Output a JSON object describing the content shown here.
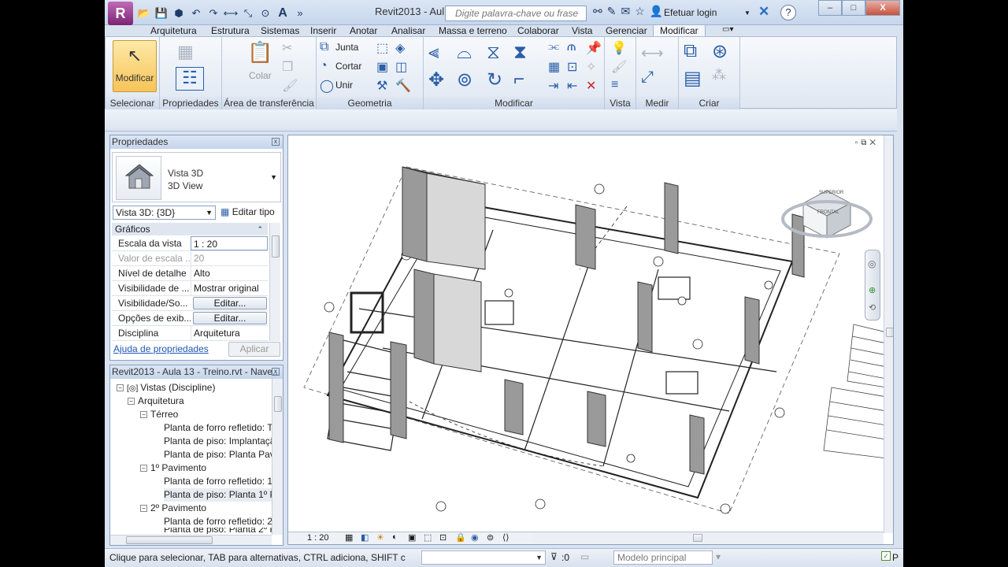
{
  "app": {
    "logo_letter": "R",
    "title": "Revit2013 - Aul...",
    "search_placeholder": "Digite palavra-chave ou frase",
    "login_label": "Efetuar login",
    "window_controls": [
      "–",
      "□",
      "X"
    ]
  },
  "tabs": [
    {
      "label": "Arquitetura",
      "active": false
    },
    {
      "label": "Estrutura",
      "active": false
    },
    {
      "label": "Sistemas",
      "active": false
    },
    {
      "label": "Inserir",
      "active": false
    },
    {
      "label": "Anotar",
      "active": false
    },
    {
      "label": "Analisar",
      "active": false
    },
    {
      "label": "Massa e terreno",
      "active": false
    },
    {
      "label": "Colaborar",
      "active": false
    },
    {
      "label": "Vista",
      "active": false
    },
    {
      "label": "Gerenciar",
      "active": false
    },
    {
      "label": "Modificar",
      "active": true
    }
  ],
  "ribbon": {
    "modify_button": "Modificar",
    "colar_label": "Colar",
    "geometry_items": [
      "Junta",
      "Cortar",
      "Unir"
    ],
    "panels": [
      "Selecionar",
      "Propriedades",
      "Área de transferência",
      "Geometria",
      "Modificar",
      "Vista",
      "Medir",
      "Criar"
    ]
  },
  "properties": {
    "header": "Propriedades",
    "type_name_line1": "Vista 3D",
    "type_name_line2": "3D View",
    "view_selector": "Vista 3D: {3D}",
    "edit_type": "Editar tipo",
    "group": "Gráficos",
    "rows": [
      {
        "key": "Escala da vista",
        "value": "1 : 20",
        "style": "box"
      },
      {
        "key": "Valor de escala ...",
        "value": "20",
        "style": "dim"
      },
      {
        "key": "Nível de detalhe",
        "value": "Alto",
        "style": "plain"
      },
      {
        "key": "Visibilidade de ...",
        "value": "Mostrar original",
        "style": "plain"
      },
      {
        "key": "Visibilidade/So...",
        "value": "Editar...",
        "style": "button"
      },
      {
        "key": "Opções de exib...",
        "value": "Editar...",
        "style": "button"
      },
      {
        "key": "Disciplina",
        "value": "Arquitetura",
        "style": "plain"
      }
    ],
    "help_link": "Ajuda de propriedades",
    "apply": "Aplicar"
  },
  "browser": {
    "header": "Revit2013 - Aula 13 - Treino.rvt - Nave...",
    "items": [
      {
        "label": "Vistas (Discipline)",
        "level": 0,
        "toggle": "-",
        "icon": true
      },
      {
        "label": "Arquitetura",
        "level": 1,
        "toggle": "-"
      },
      {
        "label": "Térreo",
        "level": 2,
        "toggle": "-"
      },
      {
        "label": "Planta de forro refletido: T",
        "level": 3
      },
      {
        "label": "Planta de piso: Implantaçã",
        "level": 3
      },
      {
        "label": "Planta de piso: Planta Pav",
        "level": 3
      },
      {
        "label": "1º Pavimento",
        "level": 2,
        "toggle": "-"
      },
      {
        "label": "Planta de forro refletido: 1",
        "level": 3
      },
      {
        "label": "Planta de piso: Planta 1º P",
        "level": 3,
        "selected": true
      },
      {
        "label": "2º Pavimento",
        "level": 2,
        "toggle": "-"
      },
      {
        "label": "Planta de forro refletido: 2",
        "level": 3
      },
      {
        "label": "Planta de piso: Planta 2º P",
        "level": 3
      }
    ]
  },
  "viewport": {
    "scale": "1 : 20",
    "viewcube_top": "SUPERIOR",
    "viewcube_front": "FRONTAL",
    "accent_color": "#f7c458"
  },
  "status": {
    "hint": "Clique para selecionar, TAB para alternativas, CTRL adiciona, SHIFT cancela",
    "selection_count": ":0",
    "model": "Modelo principal"
  }
}
